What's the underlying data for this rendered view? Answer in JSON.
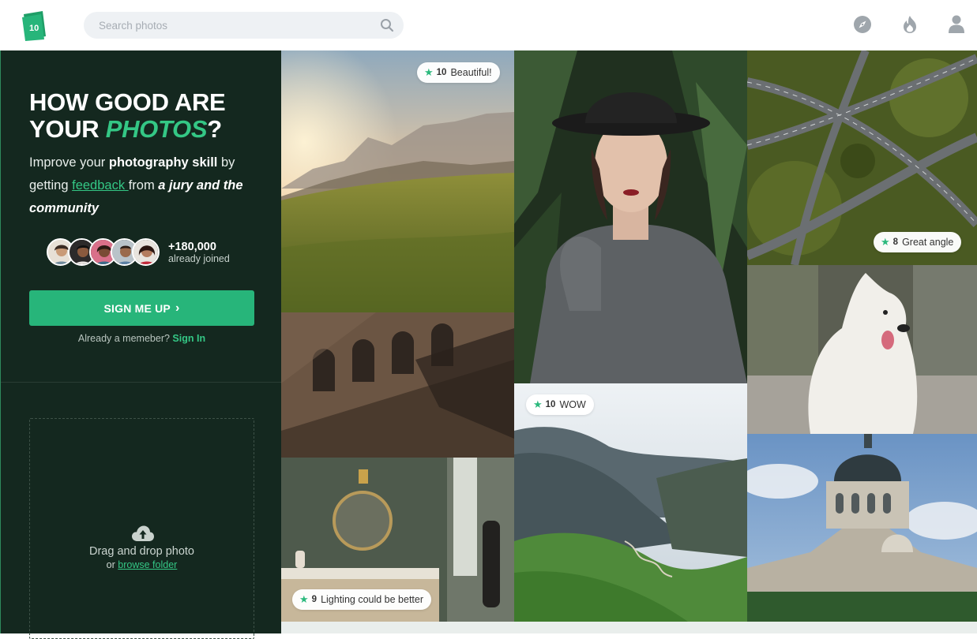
{
  "header": {
    "logo_text": "10",
    "search": {
      "placeholder": "Search photos",
      "value": ""
    },
    "nav_icons": [
      "compass-icon",
      "fire-icon",
      "user-icon"
    ]
  },
  "hero": {
    "title_line1": "HOW GOOD ARE",
    "title_line2_prefix": "YOUR ",
    "title_accent": "PHOTOS",
    "title_suffix": "?",
    "sub_1": "Improve your ",
    "sub_bold1": "photography skill",
    "sub_2": " by getting ",
    "sub_link": "feedback ",
    "sub_3": "from ",
    "sub_italic": "a jury and the community",
    "joined_count": "+180,000",
    "joined_label": "already joined",
    "signup_label": "SIGN ME UP",
    "signup_chevron": "›",
    "member_text": "Already a memeber? ",
    "signin_label": "Sign In"
  },
  "upload": {
    "title": "Drag and drop photo",
    "or_text": "or ",
    "browse_label": "browse folder"
  },
  "photos": [
    {
      "name": "photo-meadow-sunset",
      "badge": {
        "score": "10",
        "text": "Beautiful!"
      }
    },
    {
      "name": "photo-portrait-woman-hat",
      "badge": null
    },
    {
      "name": "photo-highway-aerial",
      "badge": {
        "score": "8",
        "text": "Great angle"
      }
    },
    {
      "name": "photo-brick-building",
      "badge": null
    },
    {
      "name": "photo-white-dog",
      "badge": null
    },
    {
      "name": "photo-mountain-valley",
      "badge": {
        "score": "10",
        "text": "WOW"
      }
    },
    {
      "name": "photo-bathroom-mirror",
      "badge": {
        "score": "9",
        "text": "Lighting could be better"
      }
    },
    {
      "name": "photo-domed-church",
      "badge": null
    }
  ],
  "colors": {
    "accent": "#27b57a",
    "accent_text": "#34c785",
    "panel_bg": "#14281f"
  }
}
